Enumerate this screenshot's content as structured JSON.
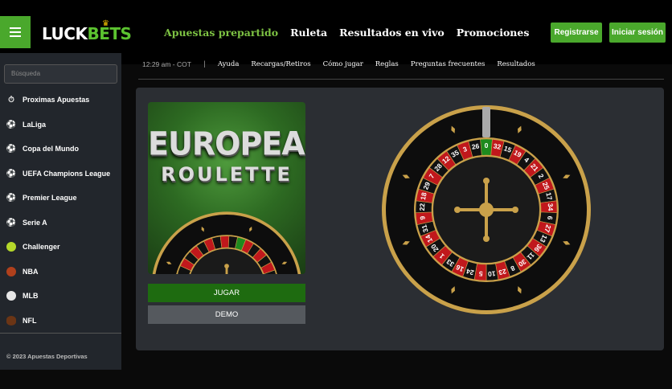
{
  "header": {
    "logo_left": "LUCK",
    "logo_right": "BETS",
    "nav": [
      {
        "label": "Apuestas prepartido"
      },
      {
        "label": "Ruleta"
      },
      {
        "label": "Resultados en vivo"
      },
      {
        "label": "Promociones"
      }
    ],
    "register_label": "Registrarse",
    "login_label": "Iniciar sesión"
  },
  "sidebar": {
    "search_placeholder": "Búsqueda",
    "items": [
      {
        "label": "Proximas Apuestas",
        "icon": "stopwatch-icon"
      },
      {
        "label": "LaLiga",
        "icon": "soccer-ball-icon"
      },
      {
        "label": "Copa del Mundo",
        "icon": "soccer-ball-icon"
      },
      {
        "label": "UEFA Champions League",
        "icon": "soccer-ball-icon"
      },
      {
        "label": "Premier League",
        "icon": "soccer-ball-icon"
      },
      {
        "label": "Serie A",
        "icon": "soccer-ball-icon"
      },
      {
        "label": "Challenger",
        "icon": "tennis-ball-icon"
      },
      {
        "label": "NBA",
        "icon": "basketball-icon"
      },
      {
        "label": "MLB",
        "icon": "baseball-icon"
      },
      {
        "label": "NFL",
        "icon": "football-icon"
      }
    ],
    "footer": "© 2023 Apuestas Deportivas"
  },
  "subnav": {
    "time": "12:29 am - COT",
    "separator": "|",
    "links": [
      "Ayuda",
      "Recargas/Retiros",
      "Cómo jugar",
      "Reglas",
      "Preguntas frecuentes",
      "Resultados"
    ]
  },
  "game": {
    "title_line1": "EUROPEAN",
    "title_line2": "ROULETTE",
    "play_label": "JUGAR",
    "demo_label": "DEMO",
    "wheel_numbers": [
      "0",
      "32",
      "15",
      "19",
      "4",
      "21",
      "2",
      "25",
      "17",
      "34",
      "6",
      "27",
      "13",
      "36",
      "11",
      "30",
      "8",
      "23",
      "10",
      "5",
      "24",
      "16",
      "33",
      "1",
      "20",
      "14",
      "31",
      "9",
      "22",
      "18",
      "29",
      "7",
      "28",
      "12",
      "35",
      "3",
      "26"
    ],
    "colors": {
      "green": "#1e8a1e",
      "red": "#c0181c",
      "black": "#111111",
      "gold": "#c9a14a"
    }
  },
  "colors": {
    "accent": "#4aa82c",
    "nav_active": "#7dc243"
  }
}
